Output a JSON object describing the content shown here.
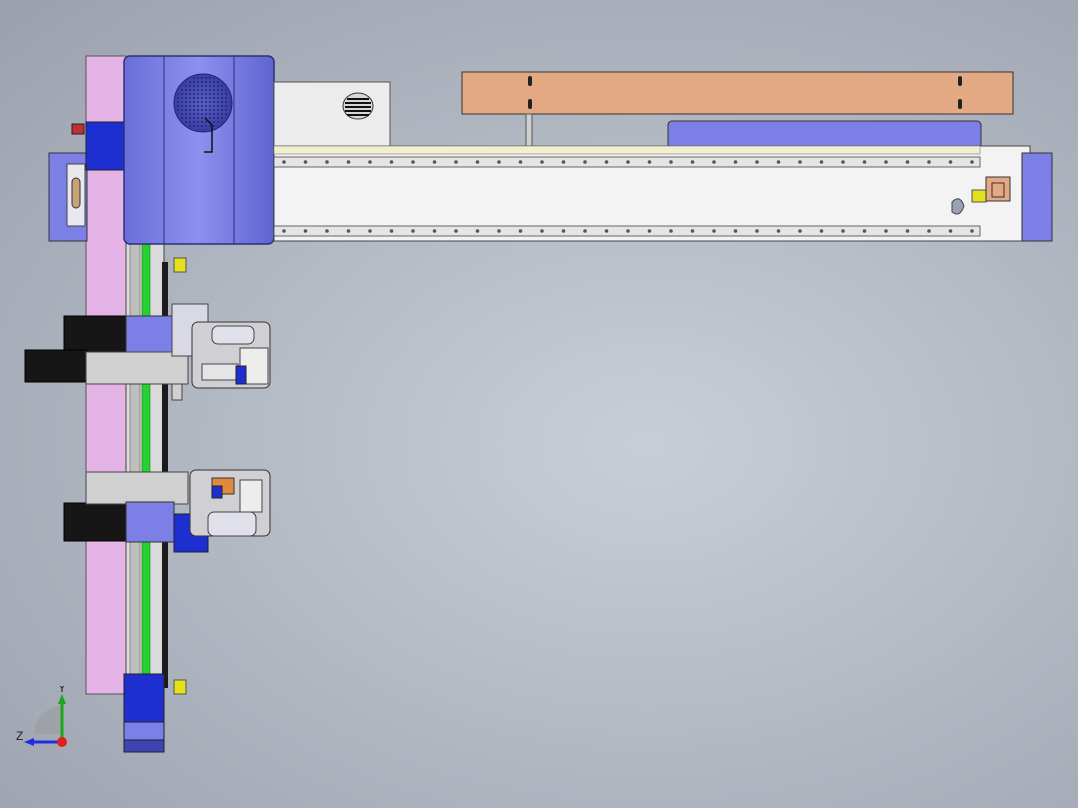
{
  "viewport": {
    "background_top": "#c9ced6",
    "background_bottom": "#9aa1ad"
  },
  "colors": {
    "body_blue": "#7b7fe6",
    "dark_blue": "#1e2fd2",
    "pink_rail": "#e4b4e6",
    "tan_plate": "#e2a983",
    "rail_white": "#f3f3f3",
    "green_strip": "#25d12f",
    "yellow_block": "#e3e11a",
    "motor_black": "#161616",
    "panel_grey": "#dcdcdc"
  },
  "triad": {
    "y_label": "Y",
    "z_label": "Z",
    "x_color": "#e11d1d",
    "y_color": "#1fa51f",
    "z_color": "#1d2fe1"
  }
}
